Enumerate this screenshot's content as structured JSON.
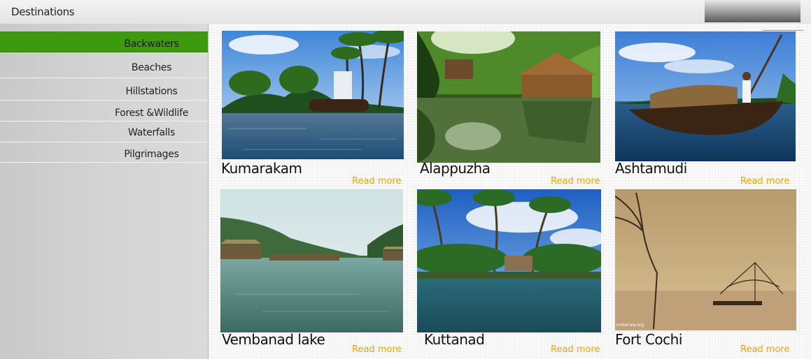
{
  "header": {
    "title": "Destinations"
  },
  "sidebar": {
    "items": [
      {
        "label": "Backwaters",
        "active": true
      },
      {
        "label": "Beaches"
      },
      {
        "label": "Hillstations"
      },
      {
        "label": "Forest &Wildlife"
      },
      {
        "label": "Waterfalls"
      },
      {
        "label": "Pilgrimages"
      }
    ]
  },
  "colors": {
    "active": "#3d9a0f",
    "read_more": "#f0a500",
    "sidebar": "#d2d2d2"
  },
  "cards": [
    {
      "title": "Kumarakam",
      "read_more": "Read more",
      "image": "backwater-houseboat-photo"
    },
    {
      "title": "Alappuzha",
      "read_more": "Read more",
      "image": "canal-hut-photo"
    },
    {
      "title": "Ashtamudi",
      "read_more": "Read more",
      "image": "boatman-kettuvallam-photo"
    },
    {
      "title": "Vembanad lake",
      "read_more": "Read more",
      "image": "lake-resort-photo"
    },
    {
      "title": "Kuttanad",
      "read_more": "Read more",
      "image": "palm-island-photo"
    },
    {
      "title": "Fort Cochi",
      "read_more": "Read more",
      "image": "chinese-fishing-net-photo"
    }
  ]
}
